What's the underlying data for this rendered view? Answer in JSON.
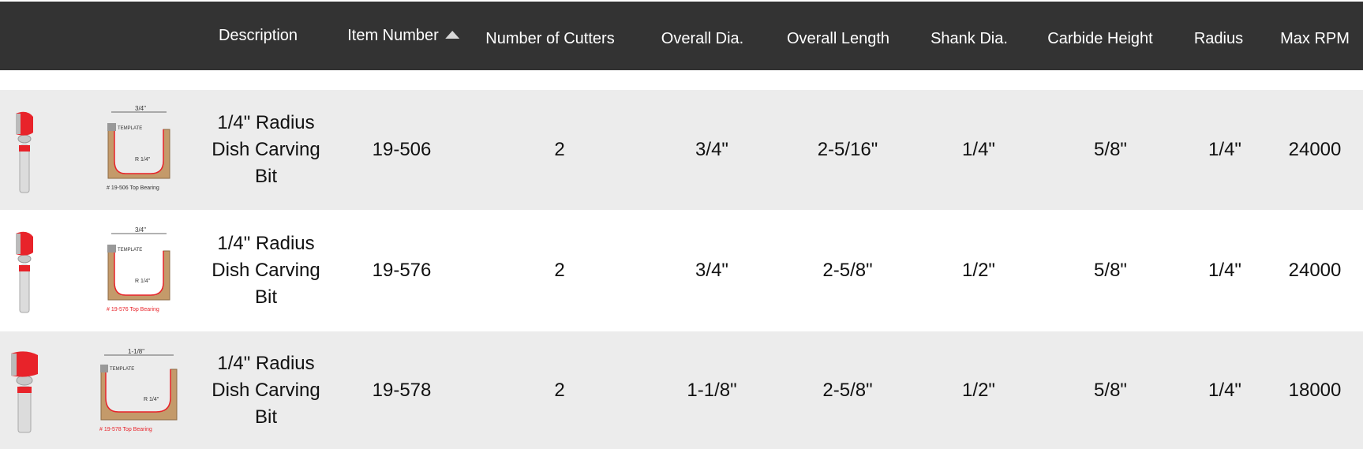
{
  "columns": {
    "description": "Description",
    "item_number": "Item Number",
    "cutters": "Number of Cutters",
    "overall_dia": "Overall Dia.",
    "overall_length": "Overall Length",
    "shank_dia": "Shank Dia.",
    "carbide_height": "Carbide Height",
    "radius": "Radius",
    "max_rpm": "Max RPM"
  },
  "sort": {
    "column": "item_number",
    "direction": "ascending",
    "icon": "sort-up-icon"
  },
  "colors": {
    "header_bg": "#333333",
    "row_alt_bg": "#ececec",
    "bit_red": "#e8232a"
  },
  "rows": [
    {
      "description": "1/4\" Radius Dish Carving Bit",
      "item_number": "19-506",
      "cutters": "2",
      "overall_dia": "3/4\"",
      "overall_length": "2-5/16\"",
      "shank_dia": "1/4\"",
      "carbide_height": "5/8\"",
      "radius": "1/4\"",
      "max_rpm": "24000",
      "diagram": {
        "width_label": "3/4\"",
        "template_label": "TEMPLATE",
        "radius_label": "R 1/4\"",
        "caption": "# 19-506 Top Bearing"
      }
    },
    {
      "description": "1/4\" Radius Dish Carving Bit",
      "item_number": "19-576",
      "cutters": "2",
      "overall_dia": "3/4\"",
      "overall_length": "2-5/8\"",
      "shank_dia": "1/2\"",
      "carbide_height": "5/8\"",
      "radius": "1/4\"",
      "max_rpm": "24000",
      "diagram": {
        "width_label": "3/4\"",
        "template_label": "TEMPLATE",
        "radius_label": "R 1/4\"",
        "caption": "# 19-576 Top Bearing"
      }
    },
    {
      "description": "1/4\" Radius Dish Carving Bit",
      "item_number": "19-578",
      "cutters": "2",
      "overall_dia": "1-1/8\"",
      "overall_length": "2-5/8\"",
      "shank_dia": "1/2\"",
      "carbide_height": "5/8\"",
      "radius": "1/4\"",
      "max_rpm": "18000",
      "diagram": {
        "width_label": "1-1/8\"",
        "template_label": "TEMPLATE",
        "radius_label": "R 1/4\"",
        "caption": "# 19-578 Top Bearing"
      }
    }
  ]
}
